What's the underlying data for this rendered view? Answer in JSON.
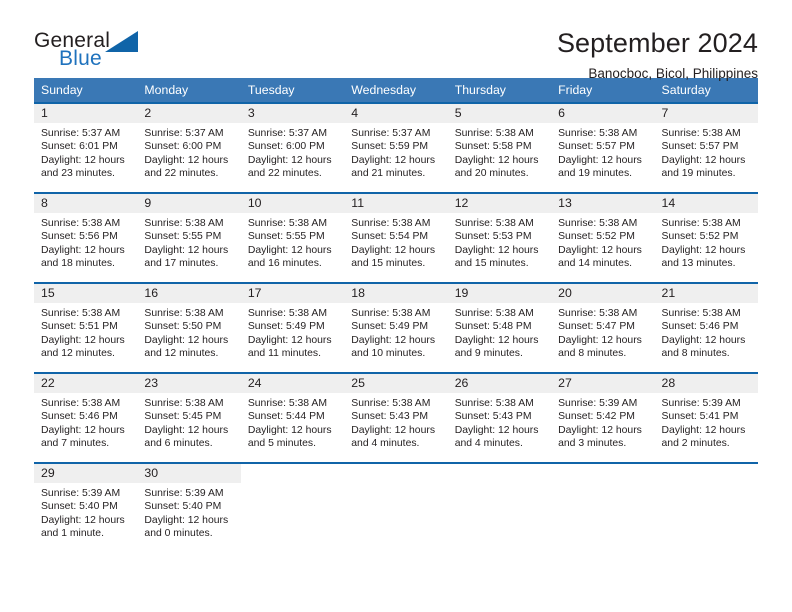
{
  "brand": {
    "name_part1": "General",
    "name_part2": "Blue",
    "logo_icon": "triangle-icon"
  },
  "header": {
    "title": "September 2024",
    "subtitle": "Banocboc, Bicol, Philippines"
  },
  "colors": {
    "header_blue": "#3a78b5",
    "row_border_blue": "#1064a8",
    "daynum_band": "#efefef",
    "brand_blue": "#1f72bd",
    "text": "#231f20"
  },
  "weekday_headers": [
    "Sunday",
    "Monday",
    "Tuesday",
    "Wednesday",
    "Thursday",
    "Friday",
    "Saturday"
  ],
  "weeks": [
    [
      {
        "day": "1",
        "sunrise": "Sunrise: 5:37 AM",
        "sunset": "Sunset: 6:01 PM",
        "daylight_line1": "Daylight: 12 hours",
        "daylight_line2": "and 23 minutes."
      },
      {
        "day": "2",
        "sunrise": "Sunrise: 5:37 AM",
        "sunset": "Sunset: 6:00 PM",
        "daylight_line1": "Daylight: 12 hours",
        "daylight_line2": "and 22 minutes."
      },
      {
        "day": "3",
        "sunrise": "Sunrise: 5:37 AM",
        "sunset": "Sunset: 6:00 PM",
        "daylight_line1": "Daylight: 12 hours",
        "daylight_line2": "and 22 minutes."
      },
      {
        "day": "4",
        "sunrise": "Sunrise: 5:37 AM",
        "sunset": "Sunset: 5:59 PM",
        "daylight_line1": "Daylight: 12 hours",
        "daylight_line2": "and 21 minutes."
      },
      {
        "day": "5",
        "sunrise": "Sunrise: 5:38 AM",
        "sunset": "Sunset: 5:58 PM",
        "daylight_line1": "Daylight: 12 hours",
        "daylight_line2": "and 20 minutes."
      },
      {
        "day": "6",
        "sunrise": "Sunrise: 5:38 AM",
        "sunset": "Sunset: 5:57 PM",
        "daylight_line1": "Daylight: 12 hours",
        "daylight_line2": "and 19 minutes."
      },
      {
        "day": "7",
        "sunrise": "Sunrise: 5:38 AM",
        "sunset": "Sunset: 5:57 PM",
        "daylight_line1": "Daylight: 12 hours",
        "daylight_line2": "and 19 minutes."
      }
    ],
    [
      {
        "day": "8",
        "sunrise": "Sunrise: 5:38 AM",
        "sunset": "Sunset: 5:56 PM",
        "daylight_line1": "Daylight: 12 hours",
        "daylight_line2": "and 18 minutes."
      },
      {
        "day": "9",
        "sunrise": "Sunrise: 5:38 AM",
        "sunset": "Sunset: 5:55 PM",
        "daylight_line1": "Daylight: 12 hours",
        "daylight_line2": "and 17 minutes."
      },
      {
        "day": "10",
        "sunrise": "Sunrise: 5:38 AM",
        "sunset": "Sunset: 5:55 PM",
        "daylight_line1": "Daylight: 12 hours",
        "daylight_line2": "and 16 minutes."
      },
      {
        "day": "11",
        "sunrise": "Sunrise: 5:38 AM",
        "sunset": "Sunset: 5:54 PM",
        "daylight_line1": "Daylight: 12 hours",
        "daylight_line2": "and 15 minutes."
      },
      {
        "day": "12",
        "sunrise": "Sunrise: 5:38 AM",
        "sunset": "Sunset: 5:53 PM",
        "daylight_line1": "Daylight: 12 hours",
        "daylight_line2": "and 15 minutes."
      },
      {
        "day": "13",
        "sunrise": "Sunrise: 5:38 AM",
        "sunset": "Sunset: 5:52 PM",
        "daylight_line1": "Daylight: 12 hours",
        "daylight_line2": "and 14 minutes."
      },
      {
        "day": "14",
        "sunrise": "Sunrise: 5:38 AM",
        "sunset": "Sunset: 5:52 PM",
        "daylight_line1": "Daylight: 12 hours",
        "daylight_line2": "and 13 minutes."
      }
    ],
    [
      {
        "day": "15",
        "sunrise": "Sunrise: 5:38 AM",
        "sunset": "Sunset: 5:51 PM",
        "daylight_line1": "Daylight: 12 hours",
        "daylight_line2": "and 12 minutes."
      },
      {
        "day": "16",
        "sunrise": "Sunrise: 5:38 AM",
        "sunset": "Sunset: 5:50 PM",
        "daylight_line1": "Daylight: 12 hours",
        "daylight_line2": "and 12 minutes."
      },
      {
        "day": "17",
        "sunrise": "Sunrise: 5:38 AM",
        "sunset": "Sunset: 5:49 PM",
        "daylight_line1": "Daylight: 12 hours",
        "daylight_line2": "and 11 minutes."
      },
      {
        "day": "18",
        "sunrise": "Sunrise: 5:38 AM",
        "sunset": "Sunset: 5:49 PM",
        "daylight_line1": "Daylight: 12 hours",
        "daylight_line2": "and 10 minutes."
      },
      {
        "day": "19",
        "sunrise": "Sunrise: 5:38 AM",
        "sunset": "Sunset: 5:48 PM",
        "daylight_line1": "Daylight: 12 hours",
        "daylight_line2": "and 9 minutes."
      },
      {
        "day": "20",
        "sunrise": "Sunrise: 5:38 AM",
        "sunset": "Sunset: 5:47 PM",
        "daylight_line1": "Daylight: 12 hours",
        "daylight_line2": "and 8 minutes."
      },
      {
        "day": "21",
        "sunrise": "Sunrise: 5:38 AM",
        "sunset": "Sunset: 5:46 PM",
        "daylight_line1": "Daylight: 12 hours",
        "daylight_line2": "and 8 minutes."
      }
    ],
    [
      {
        "day": "22",
        "sunrise": "Sunrise: 5:38 AM",
        "sunset": "Sunset: 5:46 PM",
        "daylight_line1": "Daylight: 12 hours",
        "daylight_line2": "and 7 minutes."
      },
      {
        "day": "23",
        "sunrise": "Sunrise: 5:38 AM",
        "sunset": "Sunset: 5:45 PM",
        "daylight_line1": "Daylight: 12 hours",
        "daylight_line2": "and 6 minutes."
      },
      {
        "day": "24",
        "sunrise": "Sunrise: 5:38 AM",
        "sunset": "Sunset: 5:44 PM",
        "daylight_line1": "Daylight: 12 hours",
        "daylight_line2": "and 5 minutes."
      },
      {
        "day": "25",
        "sunrise": "Sunrise: 5:38 AM",
        "sunset": "Sunset: 5:43 PM",
        "daylight_line1": "Daylight: 12 hours",
        "daylight_line2": "and 4 minutes."
      },
      {
        "day": "26",
        "sunrise": "Sunrise: 5:38 AM",
        "sunset": "Sunset: 5:43 PM",
        "daylight_line1": "Daylight: 12 hours",
        "daylight_line2": "and 4 minutes."
      },
      {
        "day": "27",
        "sunrise": "Sunrise: 5:39 AM",
        "sunset": "Sunset: 5:42 PM",
        "daylight_line1": "Daylight: 12 hours",
        "daylight_line2": "and 3 minutes."
      },
      {
        "day": "28",
        "sunrise": "Sunrise: 5:39 AM",
        "sunset": "Sunset: 5:41 PM",
        "daylight_line1": "Daylight: 12 hours",
        "daylight_line2": "and 2 minutes."
      }
    ],
    [
      {
        "day": "29",
        "sunrise": "Sunrise: 5:39 AM",
        "sunset": "Sunset: 5:40 PM",
        "daylight_line1": "Daylight: 12 hours",
        "daylight_line2": "and 1 minute."
      },
      {
        "day": "30",
        "sunrise": "Sunrise: 5:39 AM",
        "sunset": "Sunset: 5:40 PM",
        "daylight_line1": "Daylight: 12 hours",
        "daylight_line2": "and 0 minutes."
      },
      {
        "day": "",
        "sunrise": "",
        "sunset": "",
        "daylight_line1": "",
        "daylight_line2": ""
      },
      {
        "day": "",
        "sunrise": "",
        "sunset": "",
        "daylight_line1": "",
        "daylight_line2": ""
      },
      {
        "day": "",
        "sunrise": "",
        "sunset": "",
        "daylight_line1": "",
        "daylight_line2": ""
      },
      {
        "day": "",
        "sunrise": "",
        "sunset": "",
        "daylight_line1": "",
        "daylight_line2": ""
      },
      {
        "day": "",
        "sunrise": "",
        "sunset": "",
        "daylight_line1": "",
        "daylight_line2": ""
      }
    ]
  ]
}
